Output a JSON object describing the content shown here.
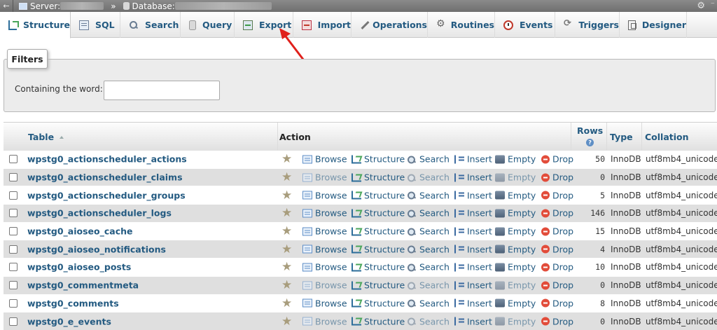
{
  "breadcrumb": {
    "server_label": "Server:",
    "database_label": "Database:",
    "separator": "»"
  },
  "tabs": [
    {
      "label": "Structure",
      "icon": "structure-icon",
      "active": true
    },
    {
      "label": "SQL",
      "icon": "sql-icon"
    },
    {
      "label": "Search",
      "icon": "search-icon"
    },
    {
      "label": "Query",
      "icon": "query-icon"
    },
    {
      "label": "Export",
      "icon": "export-icon"
    },
    {
      "label": "Import",
      "icon": "import-icon"
    },
    {
      "label": "Operations",
      "icon": "wrench-icon"
    },
    {
      "label": "Routines",
      "icon": "routines-icon"
    },
    {
      "label": "Events",
      "icon": "clock-icon"
    },
    {
      "label": "Triggers",
      "icon": "triggers-icon"
    },
    {
      "label": "Designer",
      "icon": "designer-icon"
    }
  ],
  "filters": {
    "legend": "Filters",
    "label": "Containing the word:",
    "value": "",
    "placeholder": ""
  },
  "table": {
    "headers": {
      "table": "Table",
      "action": "Action",
      "rows": "Rows",
      "type": "Type",
      "collation": "Collation"
    },
    "actions": {
      "browse": "Browse",
      "structure": "Structure",
      "search": "Search",
      "insert": "Insert",
      "empty": "Empty",
      "drop": "Drop"
    },
    "rows": [
      {
        "name": "wpstg0_actionscheduler_actions",
        "rows": "50",
        "type": "InnoDB",
        "collation": "utf8mb4_unicode_",
        "has_data": true
      },
      {
        "name": "wpstg0_actionscheduler_claims",
        "rows": "0",
        "type": "InnoDB",
        "collation": "utf8mb4_unicode_",
        "has_data": false
      },
      {
        "name": "wpstg0_actionscheduler_groups",
        "rows": "5",
        "type": "InnoDB",
        "collation": "utf8mb4_unicode_",
        "has_data": true
      },
      {
        "name": "wpstg0_actionscheduler_logs",
        "rows": "146",
        "type": "InnoDB",
        "collation": "utf8mb4_unicode_",
        "has_data": true
      },
      {
        "name": "wpstg0_aioseo_cache",
        "rows": "15",
        "type": "InnoDB",
        "collation": "utf8mb4_unicode_",
        "has_data": true
      },
      {
        "name": "wpstg0_aioseo_notifications",
        "rows": "4",
        "type": "InnoDB",
        "collation": "utf8mb4_unicode_",
        "has_data": true
      },
      {
        "name": "wpstg0_aioseo_posts",
        "rows": "10",
        "type": "InnoDB",
        "collation": "utf8mb4_unicode_",
        "has_data": true
      },
      {
        "name": "wpstg0_commentmeta",
        "rows": "0",
        "type": "InnoDB",
        "collation": "utf8mb4_unicode_",
        "has_data": false
      },
      {
        "name": "wpstg0_comments",
        "rows": "8",
        "type": "InnoDB",
        "collation": "utf8mb4_unicode_",
        "has_data": true
      },
      {
        "name": "wpstg0_e_events",
        "rows": "0",
        "type": "InnoDB",
        "collation": "utf8mb4_unicode_",
        "has_data": false
      }
    ]
  },
  "colors": {
    "link": "#235a81",
    "annotation_arrow": "#e0201b"
  }
}
